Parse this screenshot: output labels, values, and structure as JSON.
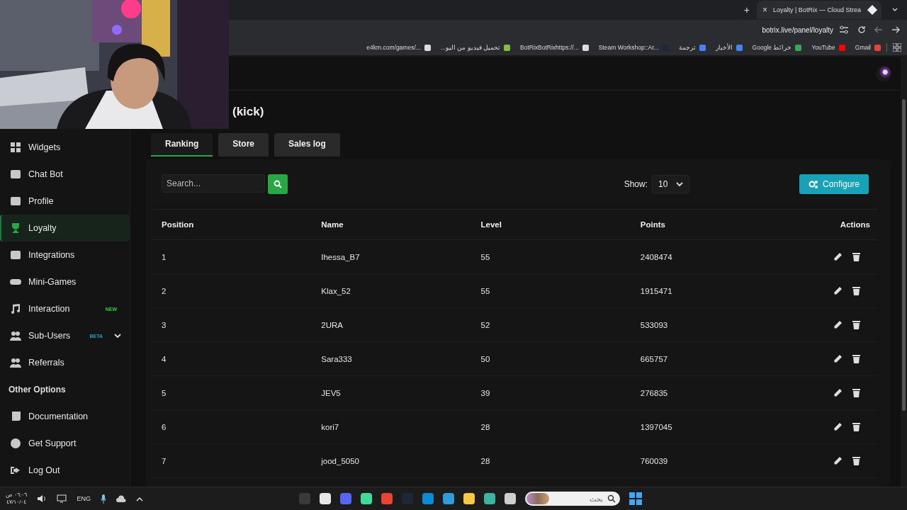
{
  "browser": {
    "tab": {
      "title": "Loyalty | BotRix — Cloud Strea",
      "close": "×",
      "selected": true
    },
    "new_tab": "+",
    "url": "botrix.live/panel/loyalty",
    "bookmarks": [
      {
        "label": "e4km.com/games/...",
        "color": "#dddddd"
      },
      {
        "label": "تحميل فيديو من اليو...",
        "color": "#7cc242"
      },
      {
        "label": "BotRixBotRixhttps://...",
        "color": "#dddddd"
      },
      {
        "label": "Steam Workshop::Ar...",
        "color": "#1b2838"
      },
      {
        "label": "ترجمة",
        "color": "#4285f4"
      },
      {
        "label": "الأخبار",
        "color": "#4285f4"
      },
      {
        "label": "خرائط Google",
        "color": "#34a853"
      },
      {
        "label": "YouTube",
        "color": "#ff0000"
      },
      {
        "label": "Gmail",
        "color": "#ea4335"
      }
    ]
  },
  "sidebar": {
    "items": [
      {
        "label": "Widgets",
        "selected": false,
        "has_submenu": false
      },
      {
        "label": "Chat Bot",
        "selected": false,
        "has_submenu": false
      },
      {
        "label": "Profile",
        "selected": false,
        "has_submenu": false
      },
      {
        "label": "Loyalty",
        "selected": true,
        "has_submenu": false
      },
      {
        "label": "Integrations",
        "selected": false,
        "has_submenu": false
      },
      {
        "label": "Mini-Games",
        "selected": false,
        "has_submenu": false
      },
      {
        "label": "Interaction",
        "selected": false,
        "has_submenu": false,
        "badge": {
          "text": "NEW",
          "color": "#2ecc40"
        }
      },
      {
        "label": "Sub-Users",
        "selected": false,
        "has_submenu": true,
        "badge": {
          "text": "BETA",
          "color": "#17a2b8"
        }
      },
      {
        "label": "Referrals",
        "selected": false,
        "has_submenu": false
      }
    ],
    "section_title": "Other Options",
    "other_items": [
      {
        "label": "Documentation"
      },
      {
        "label": "Get Support"
      },
      {
        "label": "Log Out"
      }
    ]
  },
  "page": {
    "title": "(kick)",
    "tabs": [
      {
        "label": "Ranking",
        "selected": true
      },
      {
        "label": "Store",
        "selected": false
      },
      {
        "label": "Sales log",
        "selected": false
      }
    ],
    "search": {
      "placeholder": "Search..."
    },
    "show": {
      "label": "Show:",
      "value": "10"
    },
    "configure": "Configure",
    "table": {
      "columns": [
        "Position",
        "Name",
        "Level",
        "Points",
        "Actions"
      ],
      "rows": [
        [
          "1",
          "Ihessa_B7",
          "55",
          "2408474"
        ],
        [
          "2",
          "Klax_52",
          "55",
          "1915471"
        ],
        [
          "3",
          "2URA",
          "52",
          "533093"
        ],
        [
          "4",
          "Sara333",
          "50",
          "665757"
        ],
        [
          "5",
          "JEV5",
          "39",
          "276835"
        ],
        [
          "6",
          "kori7",
          "28",
          "1397045"
        ],
        [
          "7",
          "jood_5050",
          "28",
          "760039"
        ]
      ]
    }
  },
  "taskbar": {
    "time": "٠٦:٠٦ ص",
    "date": "٤٧/١٠/٠٤",
    "language": "ENG",
    "search_placeholder": "بحث"
  }
}
